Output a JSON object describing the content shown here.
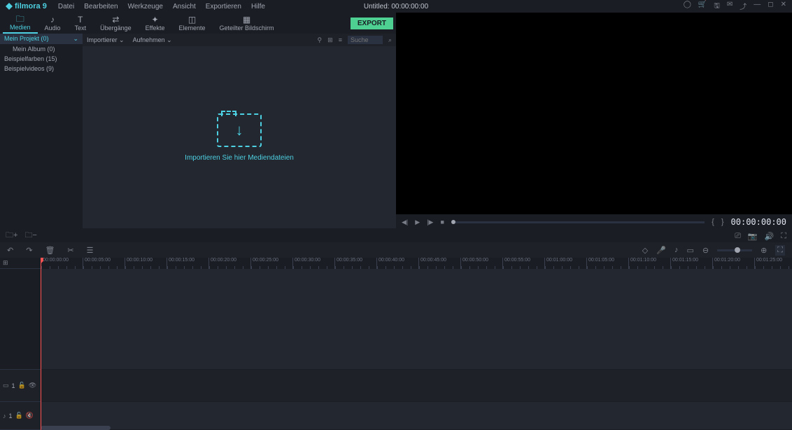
{
  "app": {
    "name": "filmora 9"
  },
  "menu": [
    "Datei",
    "Bearbeiten",
    "Werkzeuge",
    "Ansicht",
    "Exportieren",
    "Hilfe"
  ],
  "title": {
    "prefix": "Untitled:",
    "time": "00:00:00:00"
  },
  "tabs": [
    {
      "label": "Medien",
      "icon": "🗀"
    },
    {
      "label": "Audio",
      "icon": "♪"
    },
    {
      "label": "Text",
      "icon": "T"
    },
    {
      "label": "Übergänge",
      "icon": "⇄"
    },
    {
      "label": "Effekte",
      "icon": "✦"
    },
    {
      "label": "Elemente",
      "icon": "◫"
    },
    {
      "label": "Geteilter Bildschirm",
      "icon": "▦"
    }
  ],
  "export_label": "EXPORT",
  "folders": [
    {
      "label": "Mein Projekt (0)",
      "selected": true
    },
    {
      "label": "Mein Album (0)",
      "sub": true
    },
    {
      "label": "Beispielfarben (15)"
    },
    {
      "label": "Beispielvideos (9)"
    }
  ],
  "media_toolbar": {
    "importer": "Importierer",
    "record": "Aufnehmen",
    "search_placeholder": "Suche"
  },
  "dropzone_text": "Importieren Sie hier Mediendateien",
  "preview": {
    "time": "00:00:00:00",
    "brackets": {
      "open": "{",
      "close": "}"
    }
  },
  "ruler_ticks": [
    "00:00:00:00",
    "00:00:05:00",
    "00:00:10:00",
    "00:00:15:00",
    "00:00:20:00",
    "00:00:25:00",
    "00:00:30:00",
    "00:00:35:00",
    "00:00:40:00",
    "00:00:45:00",
    "00:00:50:00",
    "00:00:55:00",
    "00:01:00:00",
    "00:01:05:00",
    "00:01:10:00",
    "00:01:15:00",
    "00:01:20:00",
    "00:01:25:00"
  ],
  "tracks": {
    "video": {
      "num": "1"
    },
    "audio": {
      "num": "1"
    }
  }
}
